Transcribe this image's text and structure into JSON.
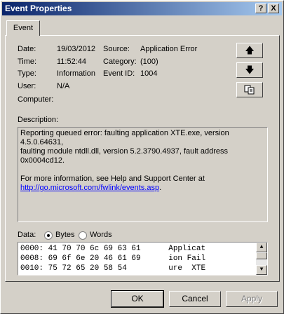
{
  "window": {
    "title": "Event Properties",
    "help_btn": "?",
    "close_btn": "X"
  },
  "tab": {
    "label": "Event"
  },
  "fields": {
    "date_label": "Date:",
    "date_value": "19/03/2012",
    "time_label": "Time:",
    "time_value": "11:52:44",
    "type_label": "Type:",
    "type_value": "Information",
    "user_label": "User:",
    "user_value": "N/A",
    "computer_label": "Computer:",
    "source_label": "Source:",
    "source_value": "Application Error",
    "category_label": "Category:",
    "category_value": "(100)",
    "eventid_label": "Event ID:",
    "eventid_value": "1004"
  },
  "description": {
    "label": "Description:",
    "line1": "Reporting queued error: faulting application XTE.exe, version 4.5.0.64631,",
    "line2": "faulting module ntdll.dll, version 5.2.3790.4937, fault address 0x0004cd12.",
    "line3": "For more information, see Help and Support Center at",
    "link": "http://go.microsoft.com/fwlink/events.asp",
    "link_suffix": "."
  },
  "data": {
    "label": "Data:",
    "bytes_label": "Bytes",
    "words_label": "Words",
    "selected": "Bytes",
    "rows": [
      "0000: 41 70 70 6c 69 63 61      Applicat",
      "0008: 69 6f 6e 20 46 61 69      ion Fail",
      "0010: 75 72 65 20 58 54         ure  XTE"
    ]
  },
  "buttons": {
    "ok": "OK",
    "cancel": "Cancel",
    "apply": "Apply"
  }
}
